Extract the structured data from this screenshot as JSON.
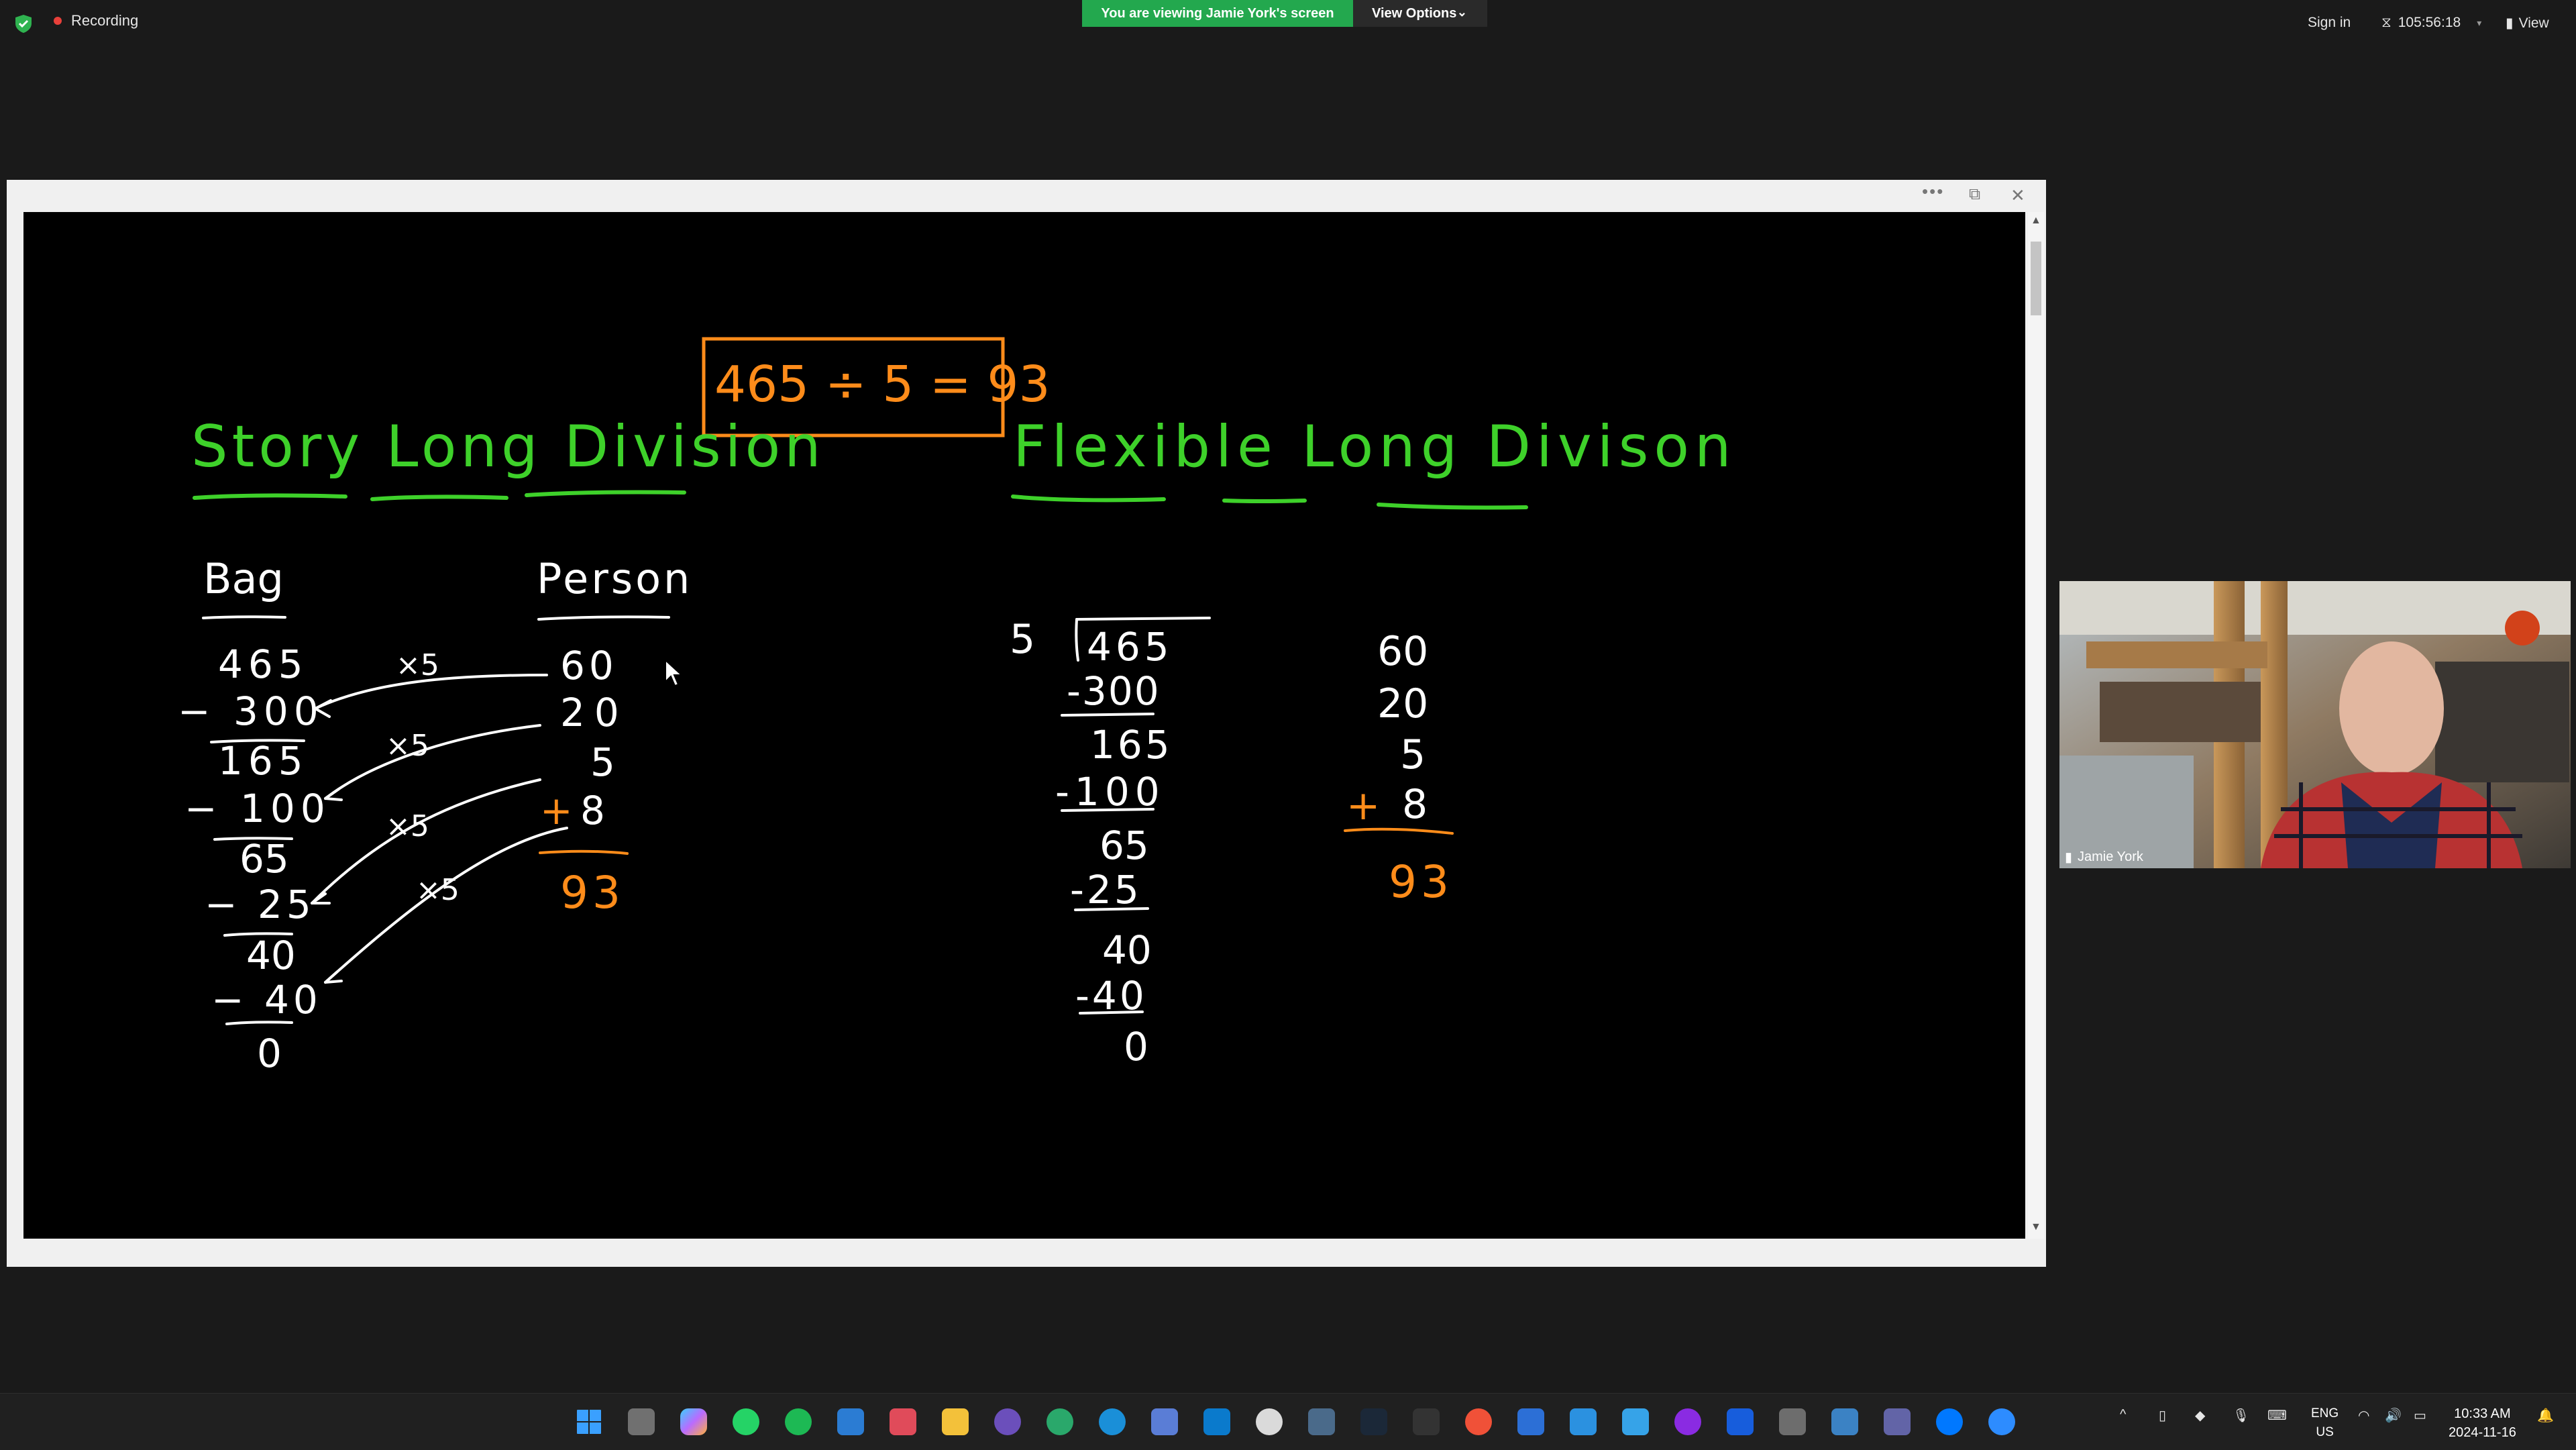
{
  "topbar": {
    "recording": "Recording",
    "viewing_banner": "You are viewing Jamie York's screen",
    "view_options": "View Options",
    "sign_in": "Sign in",
    "timer": "105:56:18",
    "view": "View"
  },
  "board": {
    "equation": "465 ÷ 5  = 93",
    "left_title": "Story Long Division",
    "right_title": "Flexible Long Divison",
    "col_bag": "Bag",
    "col_person": "Person",
    "bag_values": [
      "465",
      "− 300",
      "165",
      "− 100",
      "65",
      "− 25",
      "40",
      "− 40",
      "0"
    ],
    "person_values": [
      "60",
      "20",
      "5",
      "8"
    ],
    "person_plus": "+",
    "person_total": "93",
    "arrow_labels": [
      "×5",
      "×5",
      "×5",
      "×5"
    ],
    "divisor": "5",
    "dividend": "465",
    "flex_steps": [
      "-300",
      "165",
      "-100",
      "65",
      "-25",
      "40",
      "-40",
      "0"
    ],
    "flex_quotients": [
      "60",
      "20",
      "5",
      "8"
    ],
    "flex_plus": "+",
    "flex_total": "93"
  },
  "participant": {
    "name": "Jamie York"
  },
  "taskbar": {
    "apps": [
      "windows-start",
      "task-view",
      "copilot",
      "whatsapp",
      "spotify",
      "remote-desktop",
      "snipping-tool",
      "file-explorer",
      "github",
      "edge-beta",
      "edge",
      "app-installer",
      "vscode",
      "clock",
      "monitor",
      "steam",
      "terminal",
      "swift",
      "vscode-alt",
      "capture",
      "office",
      "obs",
      "bitwarden",
      "calculator",
      "notepad",
      "teams",
      "messenger",
      "zoom"
    ],
    "lang_top": "ENG",
    "lang_bottom": "US",
    "time": "10:33 AM",
    "date": "2024-11-16"
  }
}
